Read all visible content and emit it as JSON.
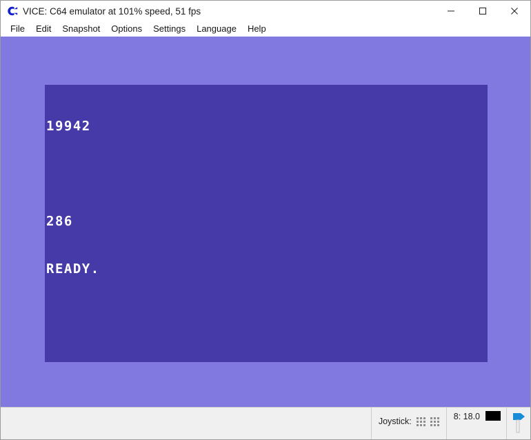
{
  "window": {
    "title": "VICE: C64 emulator at 101% speed, 51 fps",
    "icon": "commodore-c-logo",
    "controls": {
      "minimize": "minimize-icon",
      "maximize": "maximize-icon",
      "close": "close-icon"
    }
  },
  "menubar": {
    "items": [
      {
        "label": "File"
      },
      {
        "label": "Edit"
      },
      {
        "label": "Snapshot"
      },
      {
        "label": "Options"
      },
      {
        "label": "Settings"
      },
      {
        "label": "Language"
      },
      {
        "label": "Help"
      }
    ]
  },
  "emulator": {
    "border_color": "#8179e0",
    "screen_color": "#4639a8",
    "text_color": "#ffffff",
    "lines": [
      "19942",
      "",
      "286",
      "READY."
    ]
  },
  "statusbar": {
    "joystick_label": "Joystick:",
    "joystick_ports": [
      {
        "name": "joystick-port-1"
      },
      {
        "name": "joystick-port-2"
      }
    ],
    "drive_status": "8: 18.0",
    "drive_led_color": "#000000",
    "tape_icon": "tape-flag-icon",
    "tape_icon_color": "#1a8bd6"
  }
}
